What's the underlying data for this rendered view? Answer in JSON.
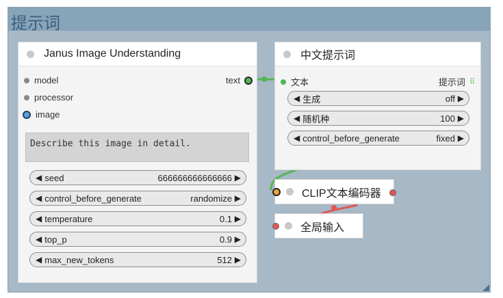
{
  "group": {
    "title": "提示词"
  },
  "janus_node": {
    "title": "Janus Image Understanding",
    "inputs": [
      "model",
      "processor",
      "image"
    ],
    "output": "text",
    "prompt_text": "Describe this image in detail.",
    "widgets": [
      {
        "label": "seed",
        "value": "666666666666666"
      },
      {
        "label": "control_before_generate",
        "value": "randomize"
      },
      {
        "label": "temperature",
        "value": "0.1"
      },
      {
        "label": "top_p",
        "value": "0.9"
      },
      {
        "label": "max_new_tokens",
        "value": "512"
      }
    ]
  },
  "chinese_prompt_node": {
    "title": "中文提示词",
    "input": "文本",
    "output": "提示词",
    "widgets": [
      {
        "label": "生成",
        "value": "off"
      },
      {
        "label": "随机种",
        "value": "100"
      },
      {
        "label": "control_before_generate",
        "value": "fixed"
      }
    ]
  },
  "clip_node": {
    "title": "CLIP文本编码器"
  },
  "global_node": {
    "title": "全局输入"
  },
  "colors": {
    "group_bg": "#a7b8c6",
    "group_header": "#88a4b9",
    "link_green": "#53b653",
    "link_red": "#e05555"
  }
}
